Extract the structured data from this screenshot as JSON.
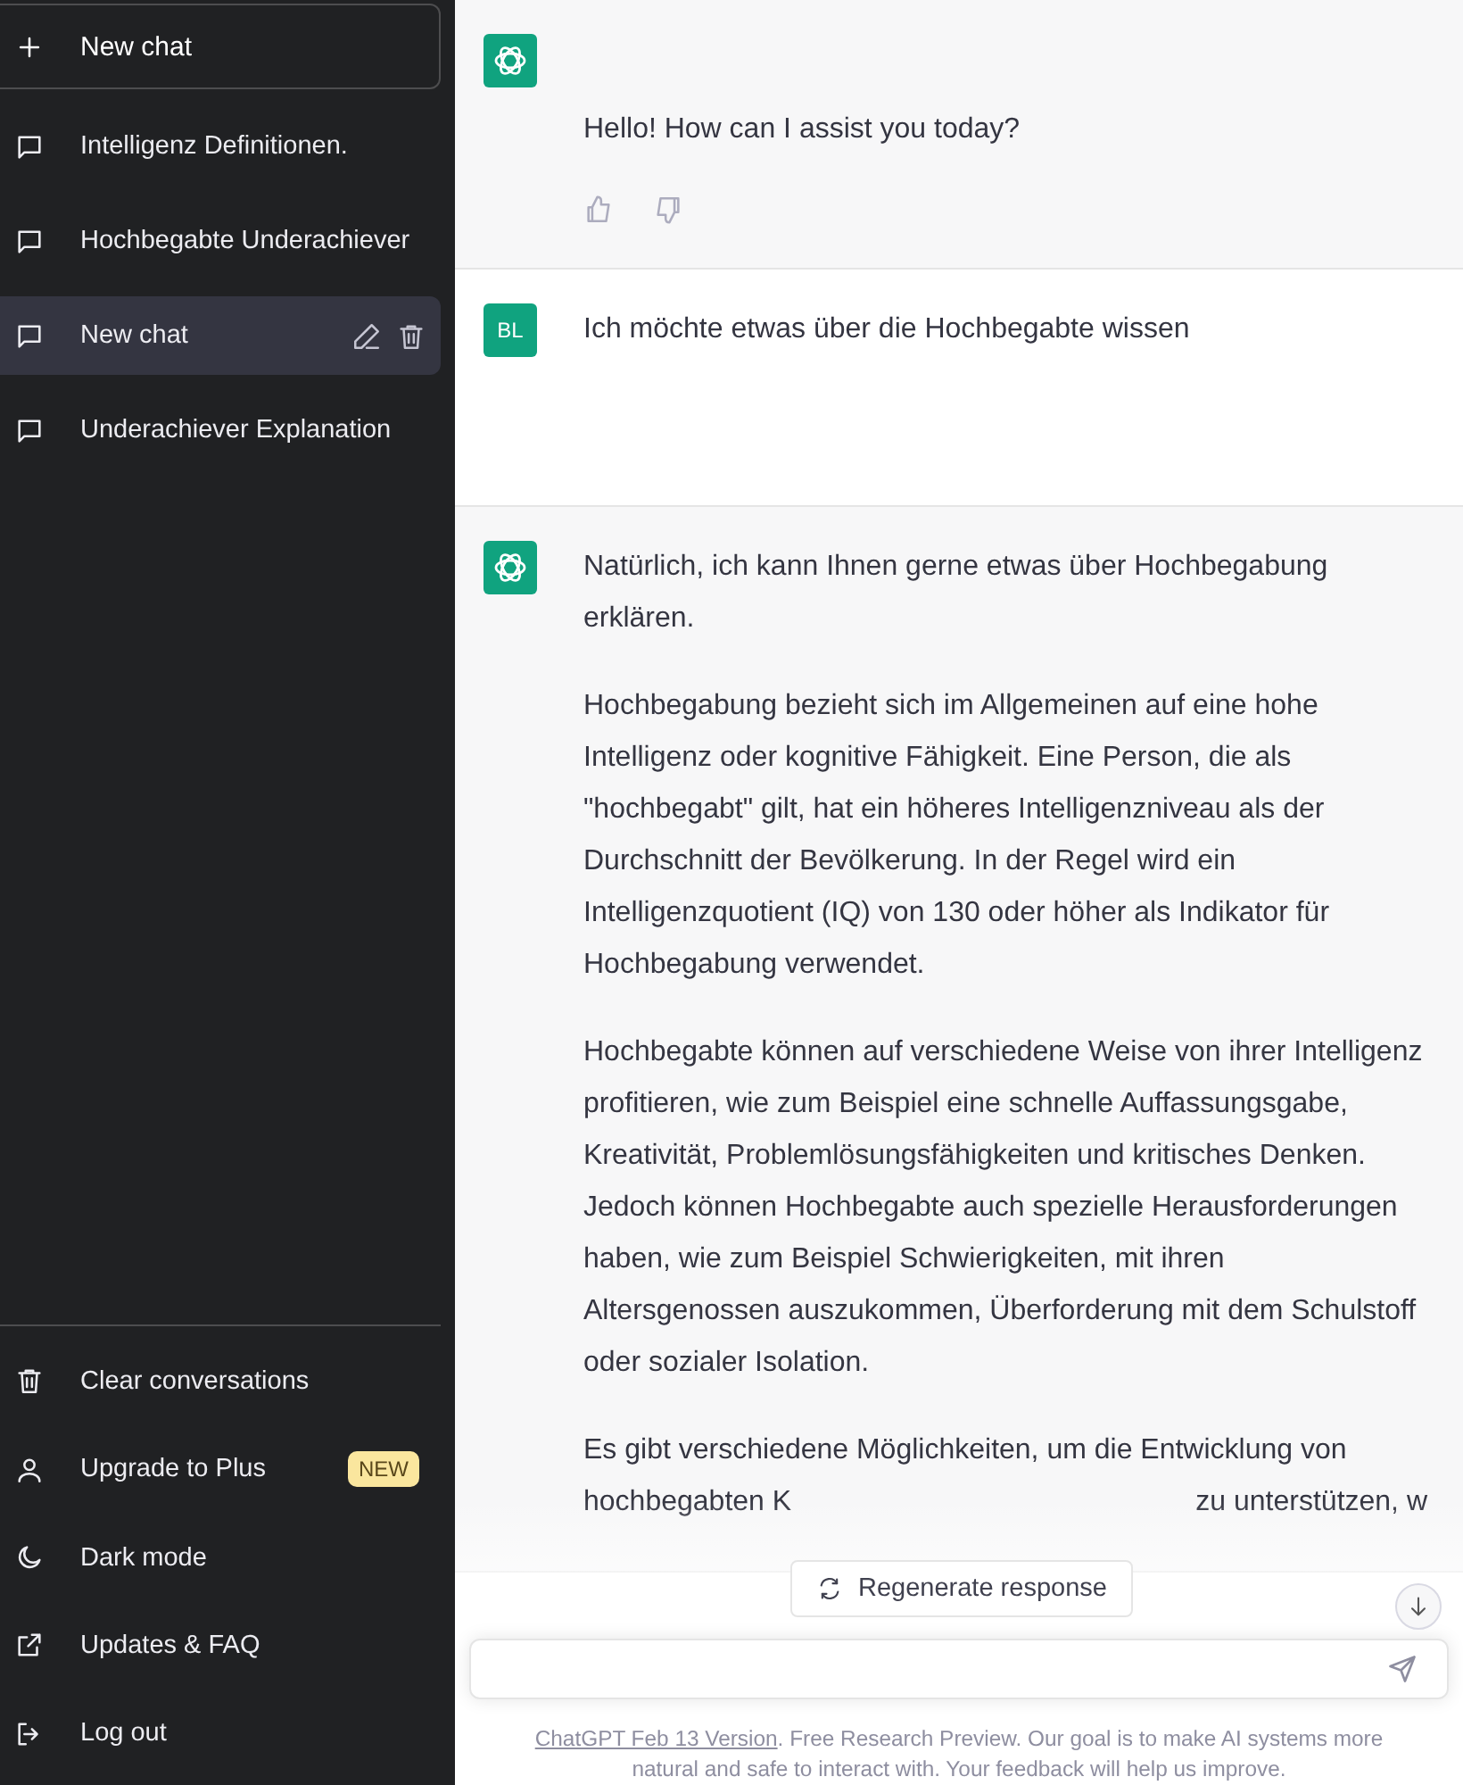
{
  "sidebar": {
    "new_chat": {
      "label": "New chat"
    },
    "conversations": [
      {
        "title": "Intelligenz Definitionen.",
        "selected": false
      },
      {
        "title": "Hochbegabte Underachiever",
        "selected": false
      },
      {
        "title": "New chat",
        "selected": true
      },
      {
        "title": "Underachiever Explanation",
        "selected": false
      }
    ],
    "menu": [
      {
        "kind": "trash",
        "label": "Clear conversations"
      },
      {
        "kind": "user",
        "label": "Upgrade to Plus",
        "badge": "NEW"
      },
      {
        "kind": "moon",
        "label": "Dark mode"
      },
      {
        "kind": "external",
        "label": "Updates & FAQ"
      },
      {
        "kind": "logout",
        "label": "Log out"
      }
    ]
  },
  "messages": [
    {
      "kind": "assistant",
      "paragraphs": [
        "Hello! How can I assist you today?"
      ],
      "feedback": true
    },
    {
      "kind": "user",
      "initials": "BL",
      "paragraphs": [
        "Ich möchte etwas über die Hochbegabte wissen"
      ]
    },
    {
      "kind": "assistant",
      "paragraphs": [
        "Natürlich, ich kann Ihnen gerne etwas über Hochbegabung erklären.",
        "Hochbegabung bezieht sich im Allgemeinen auf eine hohe Intelligenz oder kognitive Fähigkeit. Eine Person, die als \"hochbegabt\" gilt, hat ein höheres Intelligenzniveau als der Durchschnitt der Bevölkerung. In der Regel wird ein Intelligenzquotient (IQ) von 130 oder höher als Indikator für Hochbegabung verwendet.",
        "Hochbegabte können auf verschiedene Weise von ihrer Intelligenz profitieren, wie zum Beispiel eine schnelle Auffassungsgabe, Kreativität, Problemlösungsfähigkeiten und kritisches Denken. Jedoch können Hochbegabte auch spezielle Herausforderungen haben, wie zum Beispiel Schwierigkeiten, mit ihren Altersgenossen auszukommen, Überforderung mit dem Schulstoff oder sozialer Isolation.",
        "Es gibt verschiedene Möglichkeiten, um die Entwicklung von"
      ],
      "covered_line": {
        "before": "hochbegabten K",
        "after": "zu unterstützen, w"
      }
    }
  ],
  "regenerate": {
    "label": "Regenerate response"
  },
  "footer": {
    "link": "ChatGPT Feb 13 Version",
    "text": ". Free Research Preview. Our goal is to make AI systems more natural and safe to interact with. Your feedback will help us improve."
  }
}
